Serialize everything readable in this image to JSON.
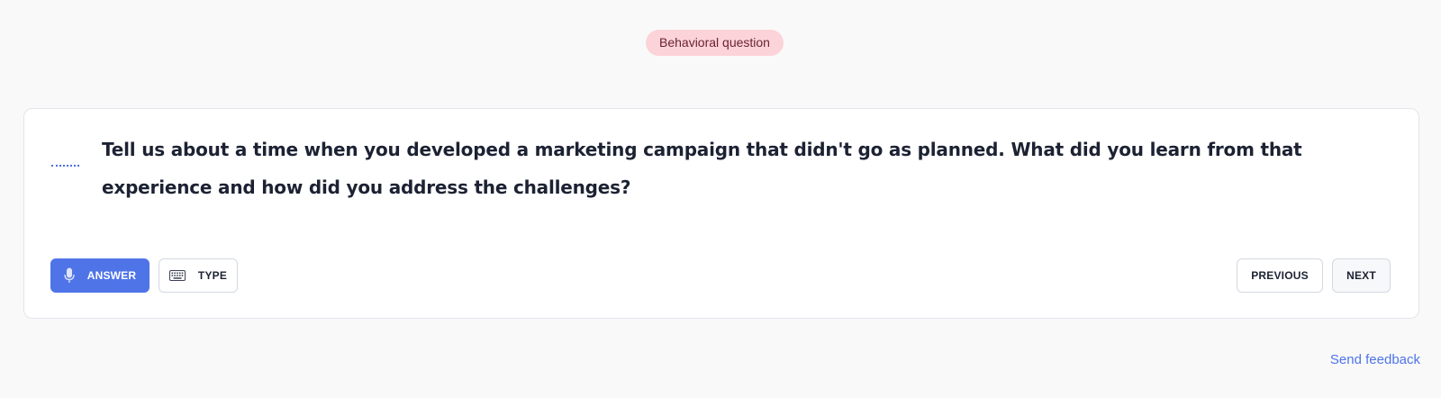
{
  "badge": {
    "label": "Behavioral question",
    "color": "#fcd3d8"
  },
  "question": {
    "text": "Tell us about a time when you developed a marketing campaign that didn't go as planned. What did you learn from that experience and how did you address the challenges?",
    "status_icon": "dotted-line-icon"
  },
  "actions": {
    "answer_label": "ANSWER",
    "answer_icon": "microphone-icon",
    "type_label": "TYPE",
    "type_icon": "keyboard-icon",
    "previous_label": "PREVIOUS",
    "next_label": "NEXT"
  },
  "footer": {
    "feedback_label": "Send feedback"
  },
  "colors": {
    "accent": "#4f74e8",
    "text": "#1c2233",
    "background": "#f9f9fa"
  }
}
